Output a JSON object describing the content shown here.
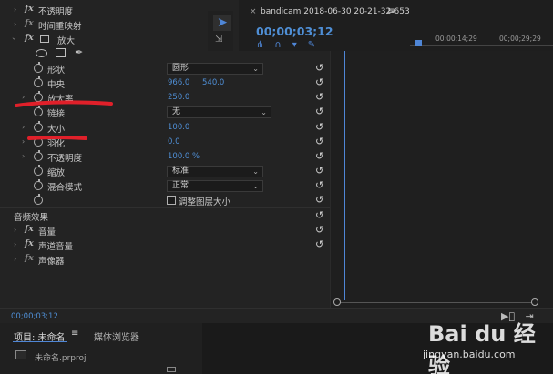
{
  "effects": {
    "opacity_label": "不透明度",
    "time_remap_label": "时间重映射",
    "magnify_label": "放大",
    "shape_label": "形状",
    "shape_value": "圆形",
    "center_label": "中央",
    "center_x": "966.0",
    "center_y": "540.0",
    "magnification_label": "放大率",
    "magnification_value": "250.0",
    "link_label": "链接",
    "link_value": "无",
    "size_label": "大小",
    "size_value": "100.0",
    "feather_label": "羽化",
    "feather_value": "0.0",
    "mag_opacity_label": "不透明度",
    "mag_opacity_value": "100.0 %",
    "scaling_label": "缩放",
    "scaling_value": "标准",
    "blend_label": "混合模式",
    "blend_value": "正常",
    "resize_layer_label": "调整图层大小",
    "audio_effects_label": "音频效果",
    "volume_label": "音量",
    "channel_volume_label": "声道音量",
    "panner_label": "声像器"
  },
  "status": {
    "time": "00;00;03;12"
  },
  "project": {
    "tab_project": "项目: 未命名",
    "tab_media": "媒体浏览器",
    "file": "未命名.prproj"
  },
  "sequence": {
    "name": "bandicam 2018-06-30 20-21-32-653",
    "time": "00;00;03;12",
    "ruler_1": "00;00;14;29",
    "ruler_2": "00;00;29;29"
  },
  "watermark": {
    "brand": "Bai du 经验",
    "url": "jingyan.baidu.com"
  },
  "colors": {
    "accent": "#4f86d6",
    "annotation": "#e0202a"
  }
}
